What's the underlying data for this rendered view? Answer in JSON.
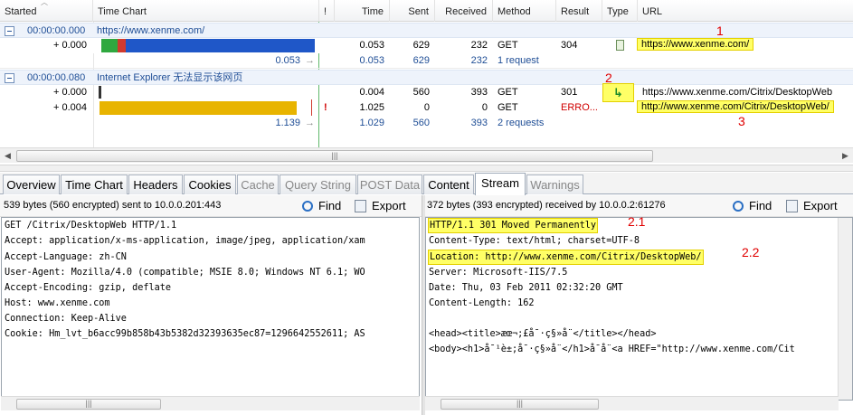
{
  "columns": {
    "started": "Started",
    "time_chart": "Time Chart",
    "flag": "!",
    "time": "Time",
    "sent": "Sent",
    "received": "Received",
    "method": "Method",
    "result": "Result",
    "type": "Type",
    "url": "URL"
  },
  "groups": [
    {
      "start": "00:00:00.000",
      "title": "https://www.xenme.com/",
      "entries": [
        {
          "offset": "+ 0.000",
          "time": "0.053",
          "sent": "629",
          "received": "232",
          "method": "GET",
          "result": "304",
          "url": "https://www.xenme.com/"
        }
      ],
      "summary": {
        "duration": "0.053",
        "time": "0.053",
        "sent": "629",
        "received": "232",
        "count": "1 request"
      }
    },
    {
      "start": "00:00:00.080",
      "title": "Internet Explorer 无法显示该网页",
      "entries": [
        {
          "offset": "+ 0.000",
          "time": "0.004",
          "sent": "560",
          "received": "393",
          "method": "GET",
          "result": "301",
          "url": "https://www.xenme.com/Citrix/DesktopWeb"
        },
        {
          "offset": "+ 0.004",
          "flag": "!",
          "time": "1.025",
          "sent": "0",
          "received": "0",
          "method": "GET",
          "result": "ERRO...",
          "url": "http://www.xenme.com/Citrix/DesktopWeb/"
        }
      ],
      "summary": {
        "duration": "1.139",
        "time": "1.029",
        "sent": "560",
        "received": "393",
        "count": "2 requests"
      }
    }
  ],
  "annotations": {
    "a1": "1",
    "a2": "2",
    "a3": "3",
    "a21": "2.1",
    "a22": "2.2"
  },
  "tabs": [
    "Overview",
    "Time Chart",
    "Headers",
    "Cookies",
    "Cache",
    "Query String",
    "POST Data",
    "Content",
    "Stream",
    "Warnings"
  ],
  "active_tab": "Stream",
  "left_pane": {
    "info": "539 bytes (560 encrypted) sent to 10.0.0.201:443",
    "find": "Find",
    "export": "Export",
    "lines": [
      "GET /Citrix/DesktopWeb HTTP/1.1",
      "Accept: application/x-ms-application, image/jpeg, application/xam",
      "Accept-Language: zh-CN",
      "User-Agent: Mozilla/4.0 (compatible; MSIE 8.0; Windows NT 6.1; WO",
      "Accept-Encoding: gzip, deflate",
      "Host: www.xenme.com",
      "Connection: Keep-Alive",
      "Cookie: Hm_lvt_b6acc99b858b43b5382d32393635ec87=1296642552611; AS"
    ]
  },
  "right_pane": {
    "info": "372 bytes (393 encrypted) received by 10.0.0.2:61276",
    "find": "Find",
    "export": "Export",
    "lines": [
      "HTTP/1.1 301 Moved Permanently",
      "Content-Type: text/html; charset=UTF-8",
      "Location: http://www.xenme.com/Citrix/DesktopWeb/",
      "Server: Microsoft-IIS/7.5",
      "Date: Thu, 03 Feb 2011 02:32:20 GMT",
      "Content-Length: 162",
      "",
      "<head><title>æœ¬;£å¯·ç§»å¨</title></head>",
      "<body><h1>å¯¹è±;å¯·ç§»å¨</h1>å¯å¨<a HREF=\"http://www.xenme.com/Cit"
    ]
  },
  "colors": {
    "accent": "#1f4e96",
    "highlight": "#ffff66",
    "annotation": "#e00000",
    "bar_blue": "#1f57c8",
    "bar_gold": "#e8b400"
  }
}
